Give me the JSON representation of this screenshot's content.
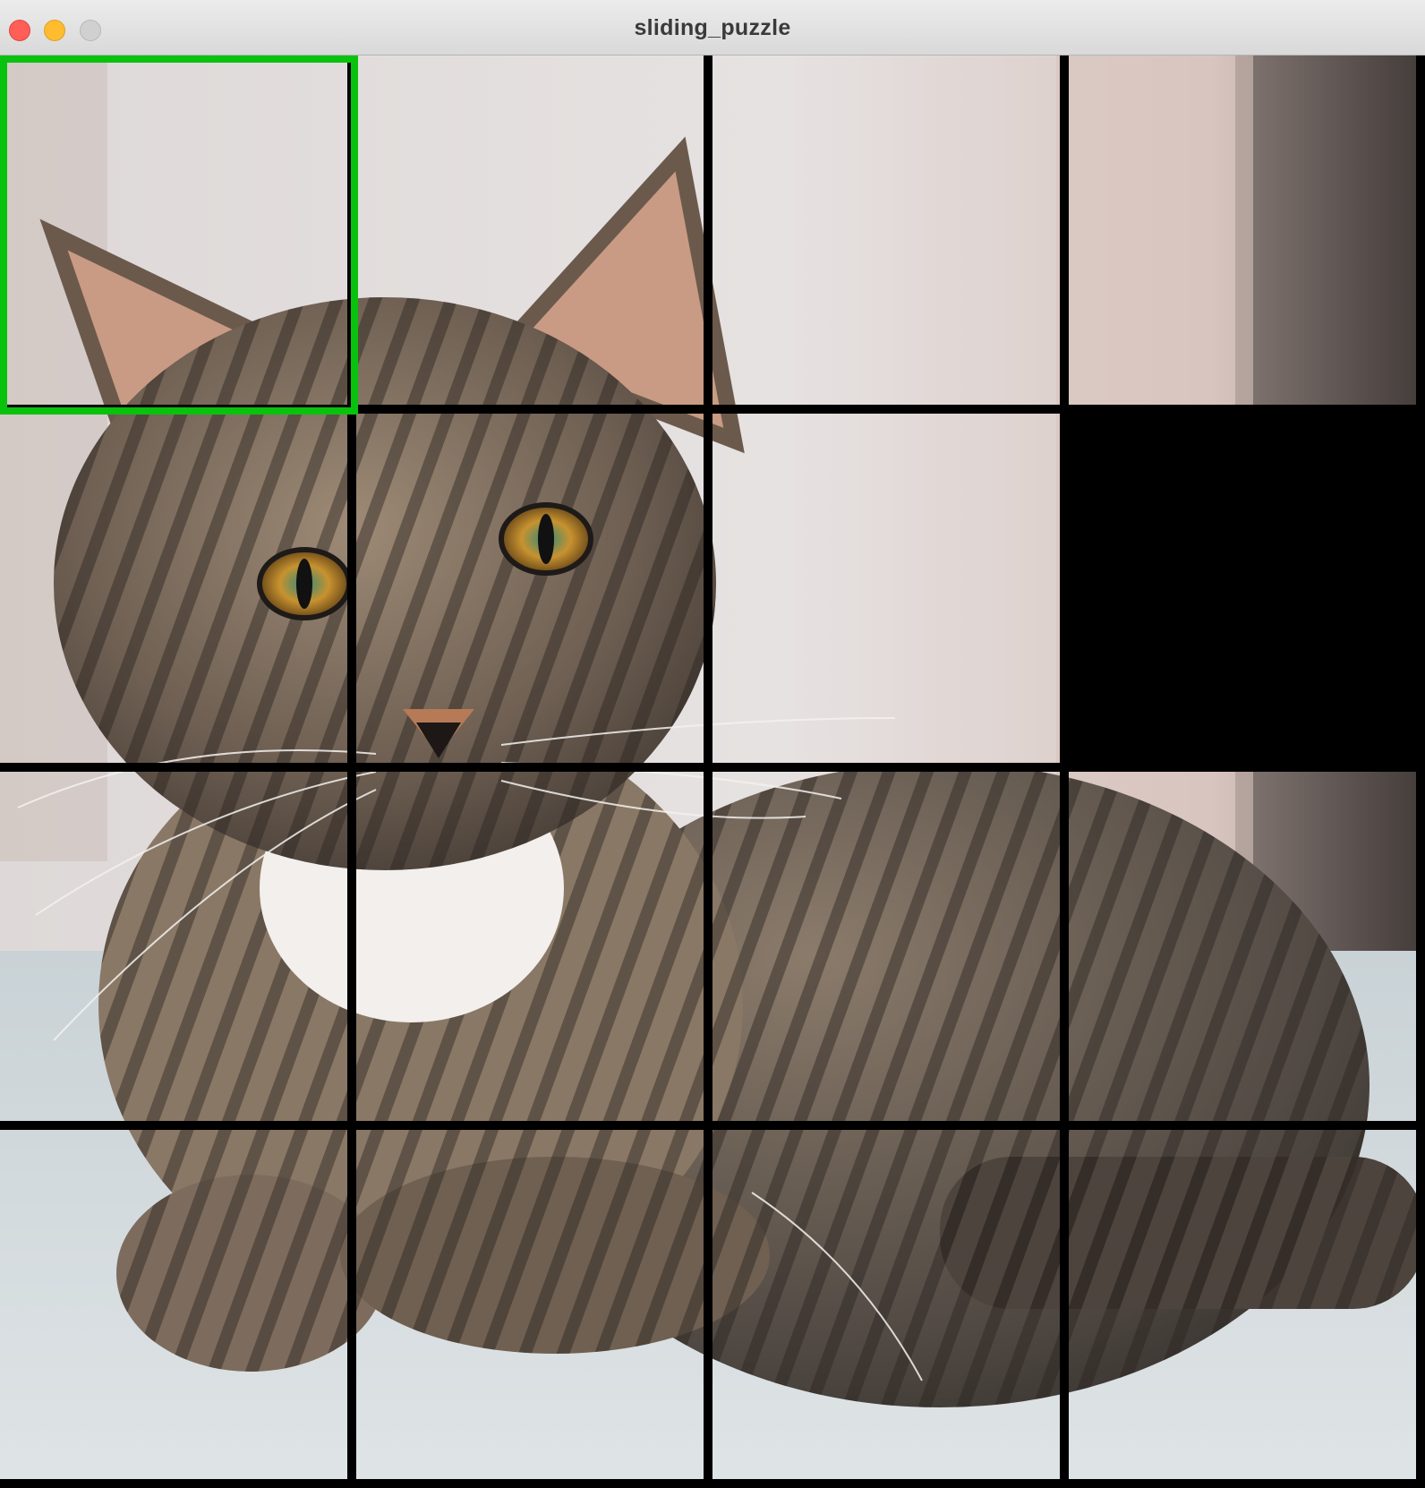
{
  "window": {
    "title": "sliding_puzzle"
  },
  "puzzle": {
    "grid_size": 4,
    "image_subject": "tabby-cat-photo",
    "selected_tile": {
      "row": 0,
      "col": 0
    },
    "empty_tile": {
      "row": 1,
      "col": 3
    },
    "tiles": [
      {
        "row": 0,
        "col": 0,
        "empty": false
      },
      {
        "row": 0,
        "col": 1,
        "empty": false
      },
      {
        "row": 0,
        "col": 2,
        "empty": false
      },
      {
        "row": 0,
        "col": 3,
        "empty": false
      },
      {
        "row": 1,
        "col": 0,
        "empty": false
      },
      {
        "row": 1,
        "col": 1,
        "empty": false
      },
      {
        "row": 1,
        "col": 2,
        "empty": false
      },
      {
        "row": 1,
        "col": 3,
        "empty": true
      },
      {
        "row": 2,
        "col": 0,
        "empty": false
      },
      {
        "row": 2,
        "col": 1,
        "empty": false
      },
      {
        "row": 2,
        "col": 2,
        "empty": false
      },
      {
        "row": 2,
        "col": 3,
        "empty": false
      },
      {
        "row": 3,
        "col": 0,
        "empty": false
      },
      {
        "row": 3,
        "col": 1,
        "empty": false
      },
      {
        "row": 3,
        "col": 2,
        "empty": false
      },
      {
        "row": 3,
        "col": 3,
        "empty": false
      }
    ],
    "colors": {
      "grid_line": "#000000",
      "selection": "#09c20d",
      "empty_tile": "#000000"
    }
  }
}
